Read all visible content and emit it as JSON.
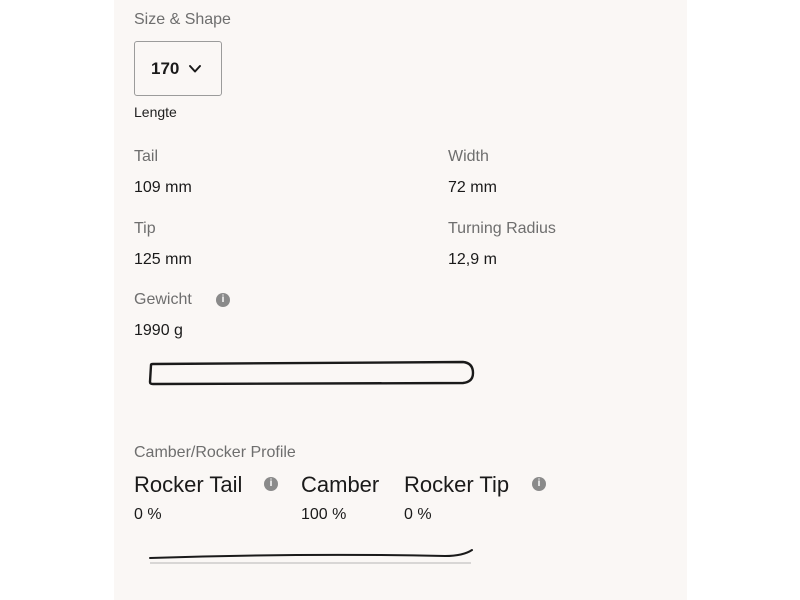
{
  "size_shape": {
    "title": "Size & Shape",
    "selected_length": "170",
    "length_caption": "Lengte"
  },
  "specs": {
    "tail_label": "Tail",
    "tail_value": "109 mm",
    "width_label": "Width",
    "width_value": "72 mm",
    "tip_label": "Tip",
    "tip_value": "125 mm",
    "turning_radius_label": "Turning Radius",
    "turning_radius_value": "12,9 m",
    "weight_label": "Gewicht",
    "weight_value": "1990 g"
  },
  "profile": {
    "title": "Camber/Rocker Profile",
    "rocker_tail_label": "Rocker Tail",
    "rocker_tail_pct": "0 %",
    "camber_label": "Camber",
    "camber_pct": "100 %",
    "rocker_tip_label": "Rocker Tip",
    "rocker_tip_pct": "0 %"
  },
  "icons": {
    "info": "info-icon",
    "dropdown": "chevron-down-icon"
  },
  "colors": {
    "panel_bg": "#faf7f5",
    "label_gray": "#6e6e6e",
    "text_dark": "#1a1a1a"
  }
}
